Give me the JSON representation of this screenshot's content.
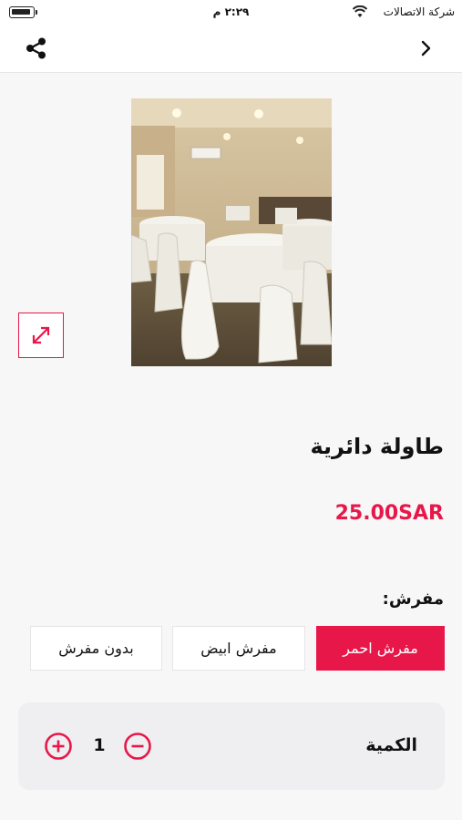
{
  "status_bar": {
    "carrier": "شركة الاتصالات",
    "time": "٢:٢٩ م"
  },
  "nav": {
    "share_icon": "share-icon",
    "back_icon": "chevron-right-icon"
  },
  "product": {
    "image_alt": "round banquet tables with white chair covers",
    "title": "طاولة دائرية",
    "price": "25.00SAR"
  },
  "options": {
    "label": "مفرش:",
    "items": [
      {
        "label": "مفرش احمر",
        "selected": true
      },
      {
        "label": "مفرش ابيض",
        "selected": false
      },
      {
        "label": "بدون مفرش",
        "selected": false
      }
    ]
  },
  "quantity": {
    "label": "الكمية",
    "value": "1"
  },
  "colors": {
    "accent": "#e8174a",
    "background": "#f7f7f7",
    "card": "#efeff1"
  }
}
